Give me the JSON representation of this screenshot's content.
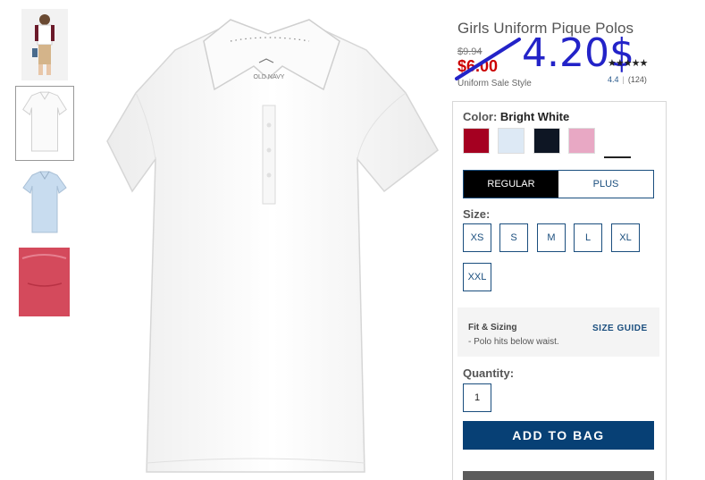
{
  "product": {
    "title": "Girls Uniform Pique Polos",
    "original_price": "$9.94",
    "sale_price": "$6.00",
    "sale_style": "Uniform Sale Style",
    "handwritten_price": "4.20$",
    "stars": "★★★★★",
    "rating": "4.4",
    "review_count": "(124)"
  },
  "thumbnails": [
    {
      "name": "thumb-model",
      "selected": false
    },
    {
      "name": "thumb-white-polo",
      "selected": true
    },
    {
      "name": "thumb-blue-polo",
      "selected": false
    },
    {
      "name": "thumb-red-polo",
      "selected": false
    }
  ],
  "color": {
    "label": "Color:",
    "selected_name": "Bright White",
    "swatches": [
      {
        "name": "red",
        "hex": "#a50021"
      },
      {
        "name": "light-blue",
        "hex": "#dde9f5"
      },
      {
        "name": "navy",
        "hex": "#0e1624"
      },
      {
        "name": "pink",
        "hex": "#e8a8c4"
      },
      {
        "name": "white",
        "hex": "#ffffff"
      }
    ]
  },
  "fit": {
    "options": [
      "REGULAR",
      "PLUS"
    ]
  },
  "size": {
    "label": "Size:",
    "options": [
      "XS",
      "S",
      "M",
      "L",
      "XL",
      "XXL"
    ]
  },
  "fit_sizing": {
    "title": "Fit & Sizing",
    "note": "- Polo hits below waist.",
    "guide_link": "SIZE GUIDE"
  },
  "quantity": {
    "label": "Quantity:",
    "value": "1"
  },
  "actions": {
    "add_to_bag": "ADD TO BAG"
  },
  "main_image": {
    "brand_tag": "OLD NAVY"
  }
}
